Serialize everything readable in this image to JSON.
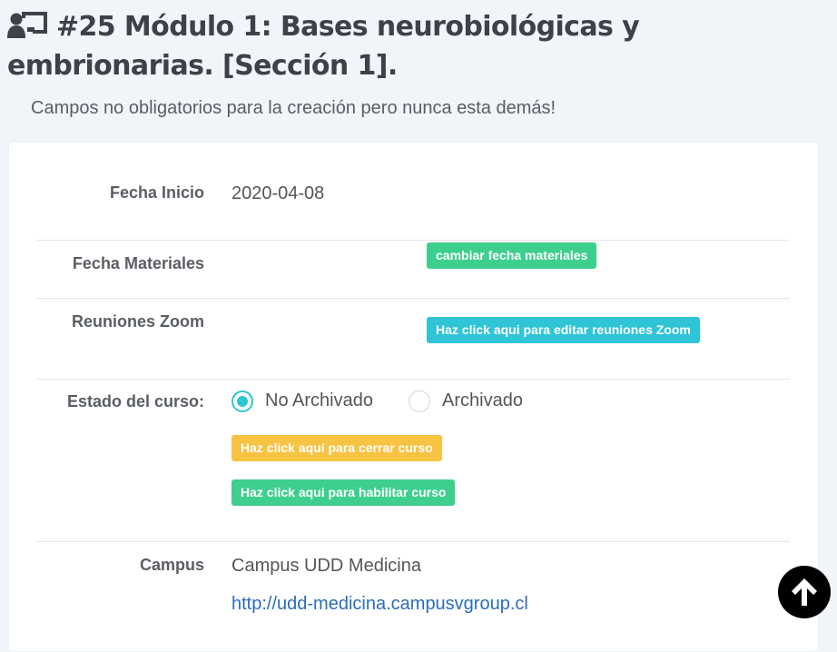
{
  "header": {
    "title": "#25 Módulo 1: Bases neurobiológicas y embrionarias. [Sección 1].",
    "subtitle": "Campos no obligatorios para la creación pero nunca esta demás!",
    "icon": "chalkboard-teacher-icon"
  },
  "fields": {
    "fecha_inicio": {
      "label": "Fecha Inicio",
      "value": "2020-04-08"
    },
    "fecha_materiales": {
      "label": "Fecha Materiales",
      "button": "cambiar fecha materiales"
    },
    "reuniones_zoom": {
      "label": "Reuniones Zoom",
      "button": "Haz click aqui para editar reuniones Zoom"
    },
    "estado": {
      "label": "Estado del curso:",
      "options": [
        "No Archivado",
        "Archivado"
      ],
      "selected": "No Archivado",
      "close_button": "Haz click aquí para cerrar curso",
      "enable_button": "Haz click aqui para habilitar curso"
    },
    "campus": {
      "label": "Campus",
      "name": "Campus UDD Medicina",
      "url": "http://udd-medicina.campusvgroup.cl"
    }
  },
  "scroll_top": {
    "icon": "arrow-up-icon"
  },
  "colors": {
    "green": "#3ecf8e",
    "cyan": "#2fc4d6",
    "yellow": "#f7c342",
    "link": "#2a6db8"
  }
}
